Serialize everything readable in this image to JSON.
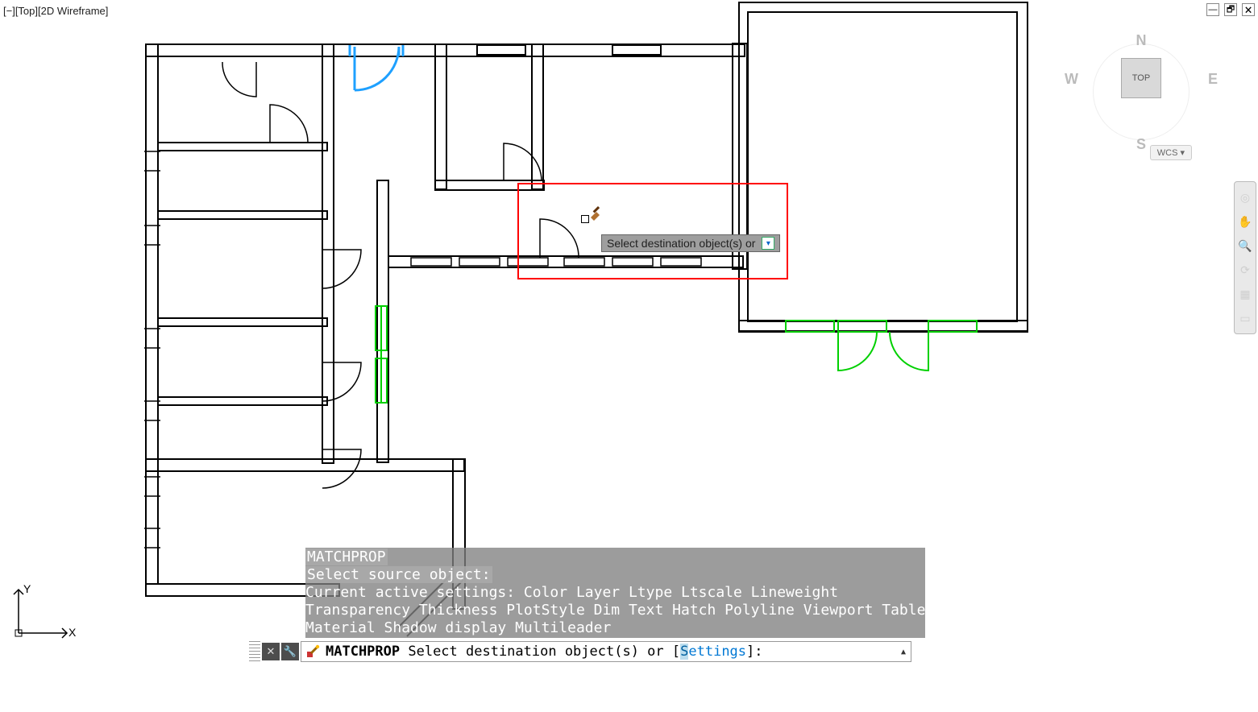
{
  "viewport_label": "[−][Top][2D Wireframe]",
  "window_controls": {
    "min": "—",
    "restore": "🗗",
    "close": "🗙"
  },
  "viewcube": {
    "n": "N",
    "s": "S",
    "w": "W",
    "e": "E",
    "top": "TOP"
  },
  "wcs": "WCS",
  "ucs": {
    "x": "X",
    "y": "Y"
  },
  "tooltip": "Select destination object(s) or",
  "history": {
    "l1": "MATCHPROP",
    "l2": "Select source object:",
    "l3": "Current active settings:  Color Layer Ltype Ltscale Lineweight",
    "l4": "Transparency Thickness PlotStyle Dim Text Hatch Polyline Viewport Table",
    "l5": "Material Shadow display Multileader"
  },
  "command_line": {
    "cmdname": "MATCHPROP",
    "prompt_pre": " Select destination object(s) or [",
    "opt_first": "S",
    "opt_rest": "ettings",
    "prompt_post": "]:"
  },
  "colors": {
    "accent_blue": "#1ea0ff",
    "green": "#00d000",
    "red_box": "#ff0000"
  }
}
